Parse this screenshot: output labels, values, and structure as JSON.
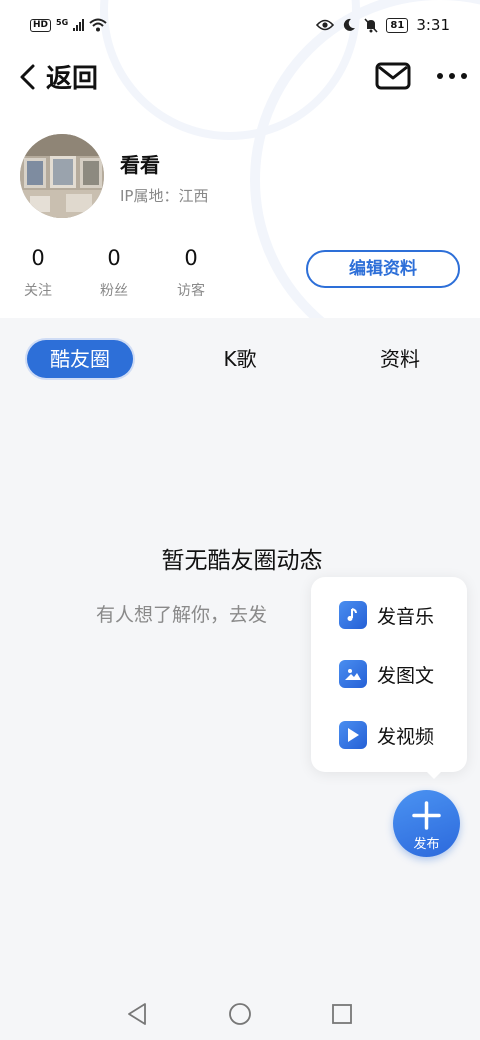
{
  "status_bar": {
    "network_badge": "HD",
    "network_type": "5G",
    "battery": "81",
    "time": "3:31"
  },
  "header": {
    "back_label": "返回",
    "icons": [
      "back-arrow-icon",
      "mail-icon",
      "more-icon"
    ]
  },
  "profile": {
    "name": "看看",
    "ip_location": "IP属地：江西",
    "stats": [
      {
        "value": "0",
        "label": "关注"
      },
      {
        "value": "0",
        "label": "粉丝"
      },
      {
        "value": "0",
        "label": "访客"
      }
    ],
    "edit_button": "编辑资料"
  },
  "tabs": [
    {
      "label": "酷友圈",
      "active": true
    },
    {
      "label": "K歌",
      "active": false
    },
    {
      "label": "资料",
      "active": false
    }
  ],
  "empty_state": {
    "title": "暂无酷友圈动态",
    "subtitle": "有人想了解你，去发"
  },
  "publish_menu": {
    "items": [
      {
        "label": "发音乐",
        "icon": "music-note-icon"
      },
      {
        "label": "发图文",
        "icon": "image-icon"
      },
      {
        "label": "发视频",
        "icon": "video-play-icon"
      }
    ],
    "fab_label": "发布"
  },
  "colors": {
    "accent": "#2d6fd8",
    "background": "#f5f6f8",
    "muted_text": "#8a8a8a"
  }
}
